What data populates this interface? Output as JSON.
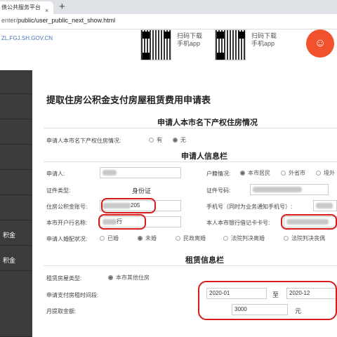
{
  "browser": {
    "tab_title": "债公共服务平台",
    "tab_close": "×",
    "new_tab": "+",
    "url_prefix": "enter/",
    "url_path": "public/user_public_next_show.html"
  },
  "header": {
    "site_url": "ZL.FGJ.SH.GOV.CN",
    "qr1_line1": "扫码下载",
    "qr1_line2": "手机app",
    "qr2_line1": "扫码下载",
    "qr2_line2": "手机app"
  },
  "sidebar": {
    "items": [
      {
        "label": ""
      },
      {
        "label": ""
      },
      {
        "label": ""
      },
      {
        "label": ""
      },
      {
        "label": ""
      },
      {
        "label": ""
      },
      {
        "label": "积金"
      },
      {
        "label": "积金"
      },
      {
        "label": ""
      }
    ]
  },
  "form": {
    "title": "提取住房公积金支付房屋租赁费用申请表",
    "section1": {
      "title": "申请人本市名下产权住房情况",
      "property_label": "申请人本市名下产权住房情况:",
      "options": [
        "有",
        "无"
      ],
      "selected": "无"
    },
    "section2": {
      "title": "申请人信息栏",
      "applicant_label": "申请人:",
      "hukou_label": "户籍情况:",
      "hukou_options": [
        "本市居民",
        "外省市",
        "境外"
      ],
      "hukou_selected": "本市居民",
      "id_type_label": "证件类型:",
      "id_type_value": "身份证",
      "id_no_label": "证件号码:",
      "fund_account_label": "住房公积金账号:",
      "fund_account_value": "205",
      "mobile_label": "手机号（同时为业务通知手机号）:",
      "bank_label": "本市开户行名称:",
      "bank_value": "行",
      "card_label": "本人本市银行借记卡卡号:",
      "marital_label": "申请人婚配状况:",
      "marital_options": [
        "已婚",
        "未婚",
        "民政离婚",
        "法院判决离婚",
        "法院判决丧偶"
      ],
      "marital_selected": "未婚"
    },
    "section3": {
      "title": "租赁信息栏",
      "house_type_label": "租赁房屋类型:",
      "house_type_value": "本市其他住房",
      "period_label": "申请支付房租时间段:",
      "period_from": "2020-01",
      "period_sep": "至",
      "period_to": "2020-12",
      "amount_label": "月提取金额:",
      "amount_value": "3000",
      "amount_unit": "元"
    }
  },
  "colors": {
    "annotation": "#d61b1b",
    "sidebar": "#3b3b3b",
    "logo": "#f0522d"
  }
}
